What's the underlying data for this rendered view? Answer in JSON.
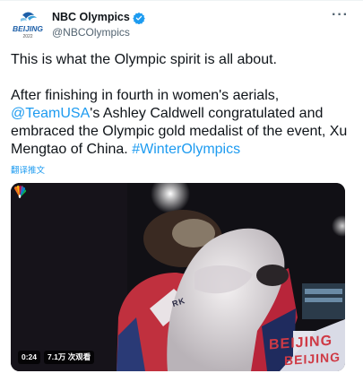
{
  "author": {
    "name": "NBC Olympics",
    "handle": "@NBCOlympics",
    "avatar_logo_text": "BEIJING",
    "avatar_logo_year": "2022"
  },
  "more_label": "···",
  "tweet": {
    "line1": "This is what the Olympic spirit is all about.",
    "p2_a": "After finishing in fourth in women's aerials, ",
    "mention": "@TeamUSA",
    "p2_b": "'s Ashley Caldwell congratulated and embraced the Olympic gold medalist of the event, Xu Mengtao of China. ",
    "hashtag": "#WinterOlympics"
  },
  "translate_label": "翻译推文",
  "video": {
    "time": "0:24",
    "views": "7.1万 次观看",
    "banner_text": "BEIJING",
    "banner_text_2": "BEIJING",
    "bib_text": "RK"
  },
  "colors": {
    "link": "#1d9bf0",
    "verified": "#1d9bf0",
    "text": "#0f1419",
    "secondary": "#536471"
  }
}
